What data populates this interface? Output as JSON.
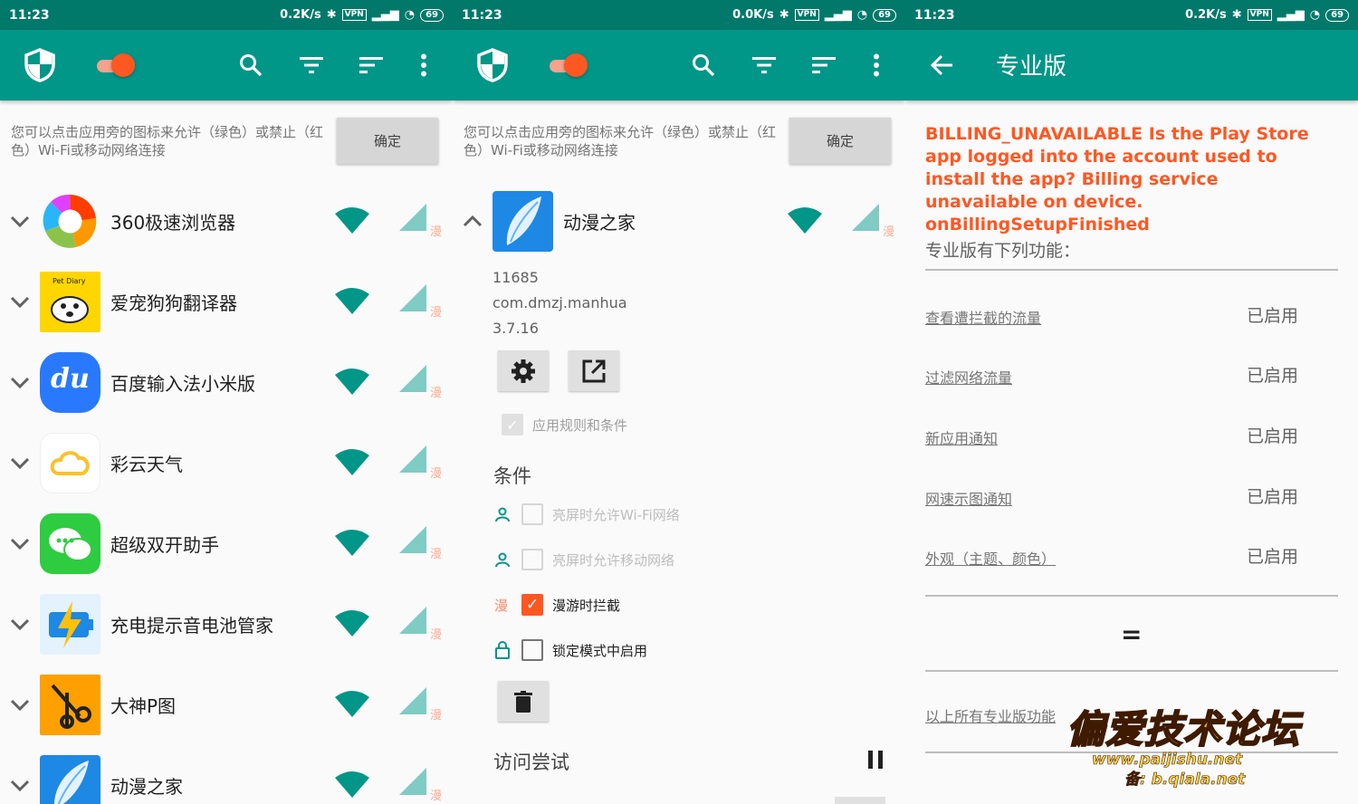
{
  "colors": {
    "primary": "#009688",
    "primary_dark": "#00796b",
    "accent": "#ff5722",
    "allow": "#009688"
  },
  "status": {
    "left": {
      "time": "11:23",
      "speed": "0.2K/s",
      "vpn": "VPN",
      "battery": "69"
    },
    "mid": {
      "time": "11:23",
      "speed": "0.0K/s",
      "vpn": "VPN",
      "battery": "69"
    },
    "right": {
      "time": "11:23",
      "speed": "0.2K/s",
      "vpn": "VPN",
      "battery": "69"
    }
  },
  "hint": {
    "text": "您可以点击应用旁的图标来允许（绿色）或禁止（红色）Wi-Fi或移动网络连接",
    "ok_label": "确定"
  },
  "roam_glyph": "漫",
  "apps": [
    {
      "name": "360极速浏览器",
      "icon": "browser-360-icon"
    },
    {
      "name": "爱宠狗狗翻译器",
      "icon": "pet-translator-icon",
      "icon_text": "Pet Diary"
    },
    {
      "name": "百度输入法小米版",
      "icon": "baidu-ime-icon",
      "icon_text": "du"
    },
    {
      "name": "彩云天气",
      "icon": "weather-cloud-icon"
    },
    {
      "name": "超级双开助手",
      "icon": "chat-bubbles-icon"
    },
    {
      "name": "充电提示音电池管家",
      "icon": "battery-bolt-icon"
    },
    {
      "name": "大神P图",
      "icon": "scissors-icon"
    },
    {
      "name": "动漫之家",
      "icon": "feather-icon"
    }
  ],
  "detail": {
    "name": "动漫之家",
    "uid": "11685",
    "package": "com.dmzj.manhua",
    "version": "3.7.16",
    "apply_rules": "应用规则和条件",
    "conditions_title": "条件",
    "conditions": [
      {
        "label": "亮屏时允许Wi-Fi网络",
        "checked": false,
        "enabled": false
      },
      {
        "label": "亮屏时允许移动网络",
        "checked": false,
        "enabled": false
      },
      {
        "label": "漫游时拦截",
        "checked": true,
        "enabled": true
      },
      {
        "label": "锁定模式中启用",
        "checked": false,
        "enabled": true
      }
    ],
    "access_title": "访问尝试"
  },
  "pro": {
    "title": "专业版",
    "error": "BILLING_UNAVAILABLE Is the Play Store app logged into the account used to install the app? Billing service unavailable on device. onBillingSetupFinished",
    "subtitle": "专业版有下列功能：",
    "features": [
      {
        "name": "查看遭拦截的流量",
        "state": "已启用"
      },
      {
        "name": "过滤网络流量",
        "state": "已启用"
      },
      {
        "name": "新应用通知",
        "state": "已启用"
      },
      {
        "name": "网速示图通知",
        "state": "已启用"
      },
      {
        "name": "外观（主题、颜色）",
        "state": "已启用"
      }
    ],
    "equals": "=",
    "all_features": "以上所有专业版功能"
  },
  "watermark": {
    "title": "偏爱技术论坛",
    "url": "www.paijishu.net",
    "backup": "备: b.qiala.net"
  }
}
